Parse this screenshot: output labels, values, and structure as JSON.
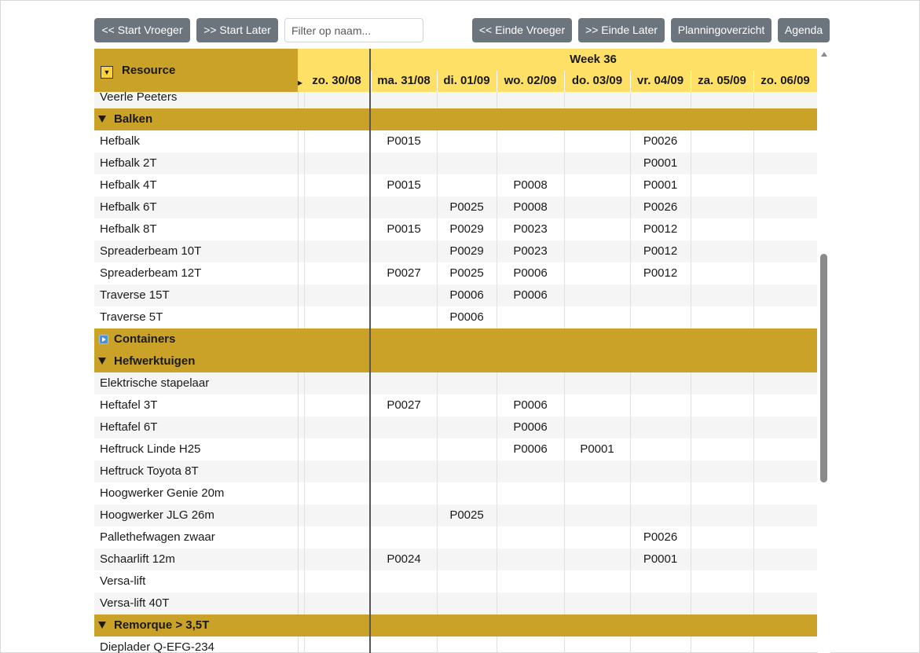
{
  "toolbar": {
    "start_earlier": "<< Start Vroeger",
    "start_later": ">> Start Later",
    "filter_placeholder": "Filter op naam...",
    "end_earlier": "<< Einde Vroeger",
    "end_later": ">> Einde Later",
    "planning_overview": "Planningoverzicht",
    "agenda": "Agenda"
  },
  "grid": {
    "resource_header": "Resource",
    "week_label": "Week 36",
    "days": [
      "zo. 30/08",
      "ma. 31/08",
      "di. 01/09",
      "wo. 02/09",
      "do. 03/09",
      "vr. 04/09",
      "za. 05/09",
      "zo. 06/09"
    ],
    "rows": [
      {
        "type": "item",
        "name": "Veerle Peeters",
        "cells": [
          "",
          "",
          "",
          "",
          "",
          "",
          "",
          ""
        ]
      },
      {
        "type": "group",
        "name": "Balken",
        "expanded": true
      },
      {
        "type": "item",
        "name": "Hefbalk",
        "cells": [
          "",
          "P0015",
          "",
          "",
          "",
          "P0026",
          "",
          ""
        ]
      },
      {
        "type": "item",
        "name": "Hefbalk 2T",
        "cells": [
          "",
          "",
          "",
          "",
          "",
          "P0001",
          "",
          ""
        ]
      },
      {
        "type": "item",
        "name": "Hefbalk 4T",
        "cells": [
          "",
          "P0015",
          "",
          "P0008",
          "",
          "P0001",
          "",
          ""
        ]
      },
      {
        "type": "item",
        "name": "Hefbalk 6T",
        "cells": [
          "",
          "",
          "P0025",
          "P0008",
          "",
          "P0026",
          "",
          ""
        ]
      },
      {
        "type": "item",
        "name": "Hefbalk 8T",
        "cells": [
          "",
          "P0015",
          "P0029",
          "P0023",
          "",
          "P0012",
          "",
          ""
        ]
      },
      {
        "type": "item",
        "name": "Spreaderbeam 10T",
        "cells": [
          "",
          "",
          "P0029",
          "P0023",
          "",
          "P0012",
          "",
          ""
        ]
      },
      {
        "type": "item",
        "name": "Spreaderbeam 12T",
        "cells": [
          "",
          "P0027",
          "P0025",
          "P0006",
          "",
          "P0012",
          "",
          ""
        ]
      },
      {
        "type": "item",
        "name": "Traverse 15T",
        "cells": [
          "",
          "",
          "P0006",
          "P0006",
          "",
          "",
          "",
          ""
        ]
      },
      {
        "type": "item",
        "name": "Traverse 5T",
        "cells": [
          "",
          "",
          "P0006",
          "",
          "",
          "",
          "",
          ""
        ]
      },
      {
        "type": "group",
        "name": "Containers",
        "expanded": false
      },
      {
        "type": "group",
        "name": "Hefwerktuigen",
        "expanded": true
      },
      {
        "type": "item",
        "name": "Elektrische stapelaar",
        "cells": [
          "",
          "",
          "",
          "",
          "",
          "",
          "",
          ""
        ]
      },
      {
        "type": "item",
        "name": "Heftafel 3T",
        "cells": [
          "",
          "P0027",
          "",
          "P0006",
          "",
          "",
          "",
          ""
        ]
      },
      {
        "type": "item",
        "name": "Heftafel 6T",
        "cells": [
          "",
          "",
          "",
          "P0006",
          "",
          "",
          "",
          ""
        ]
      },
      {
        "type": "item",
        "name": "Heftruck Linde H25",
        "cells": [
          "",
          "",
          "",
          "P0006",
          "P0001",
          "",
          "",
          ""
        ]
      },
      {
        "type": "item",
        "name": "Heftruck Toyota 8T",
        "cells": [
          "",
          "",
          "",
          "",
          "",
          "",
          "",
          ""
        ]
      },
      {
        "type": "item",
        "name": "Hoogwerker Genie 20m",
        "cells": [
          "",
          "",
          "",
          "",
          "",
          "",
          "",
          ""
        ]
      },
      {
        "type": "item",
        "name": "Hoogwerker JLG 26m",
        "cells": [
          "",
          "",
          "P0025",
          "",
          "",
          "",
          "",
          ""
        ]
      },
      {
        "type": "item",
        "name": "Pallethefwagen zwaar",
        "cells": [
          "",
          "",
          "",
          "",
          "",
          "P0026",
          "",
          ""
        ]
      },
      {
        "type": "item",
        "name": "Schaarlift 12m",
        "cells": [
          "",
          "P0024",
          "",
          "",
          "",
          "P0001",
          "",
          ""
        ]
      },
      {
        "type": "item",
        "name": "Versa-lift",
        "cells": [
          "",
          "",
          "",
          "",
          "",
          "",
          "",
          ""
        ]
      },
      {
        "type": "item",
        "name": "Versa-lift 40T",
        "cells": [
          "",
          "",
          "",
          "",
          "",
          "",
          "",
          ""
        ]
      },
      {
        "type": "group",
        "name": "Remorque > 3,5T",
        "expanded": true
      },
      {
        "type": "item",
        "name": "Dieplader Q-EFG-234",
        "cells": [
          "",
          "",
          "",
          "",
          "",
          "",
          "",
          ""
        ]
      }
    ]
  },
  "colors": {
    "header_yellow": "#ffe066",
    "group_gold": "#c9a227",
    "button_gray": "#6c757d",
    "alt_row": "#f5f5f5"
  }
}
